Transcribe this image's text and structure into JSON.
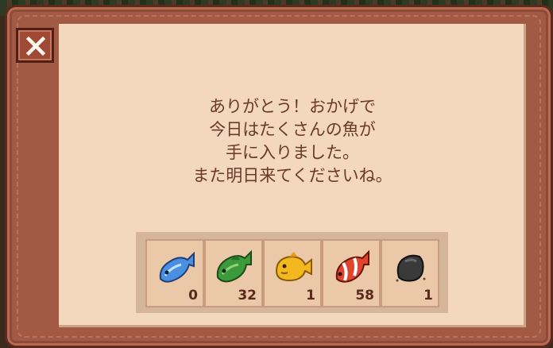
{
  "dialog": {
    "message_lines": [
      "ありがとう！おかげで",
      "今日はたくさんの魚が",
      "手に入りました。",
      "また明日来てくださいね。"
    ],
    "close_glyph": "×"
  },
  "catch_items": [
    {
      "icon": "blue-fish-icon",
      "count": "0",
      "color": "#4a8fe0"
    },
    {
      "icon": "green-fish-icon",
      "count": "32",
      "color": "#3c9a3a"
    },
    {
      "icon": "yellow-fish-icon",
      "count": "1",
      "color": "#f2b81e"
    },
    {
      "icon": "clownfish-icon",
      "count": "58",
      "color": "#e0442a"
    },
    {
      "icon": "boot-icon",
      "count": "1",
      "color": "#3a3a3a"
    }
  ],
  "colors": {
    "panel": "#f3d8be",
    "frame": "#a35a45",
    "text": "#6a3a26"
  }
}
